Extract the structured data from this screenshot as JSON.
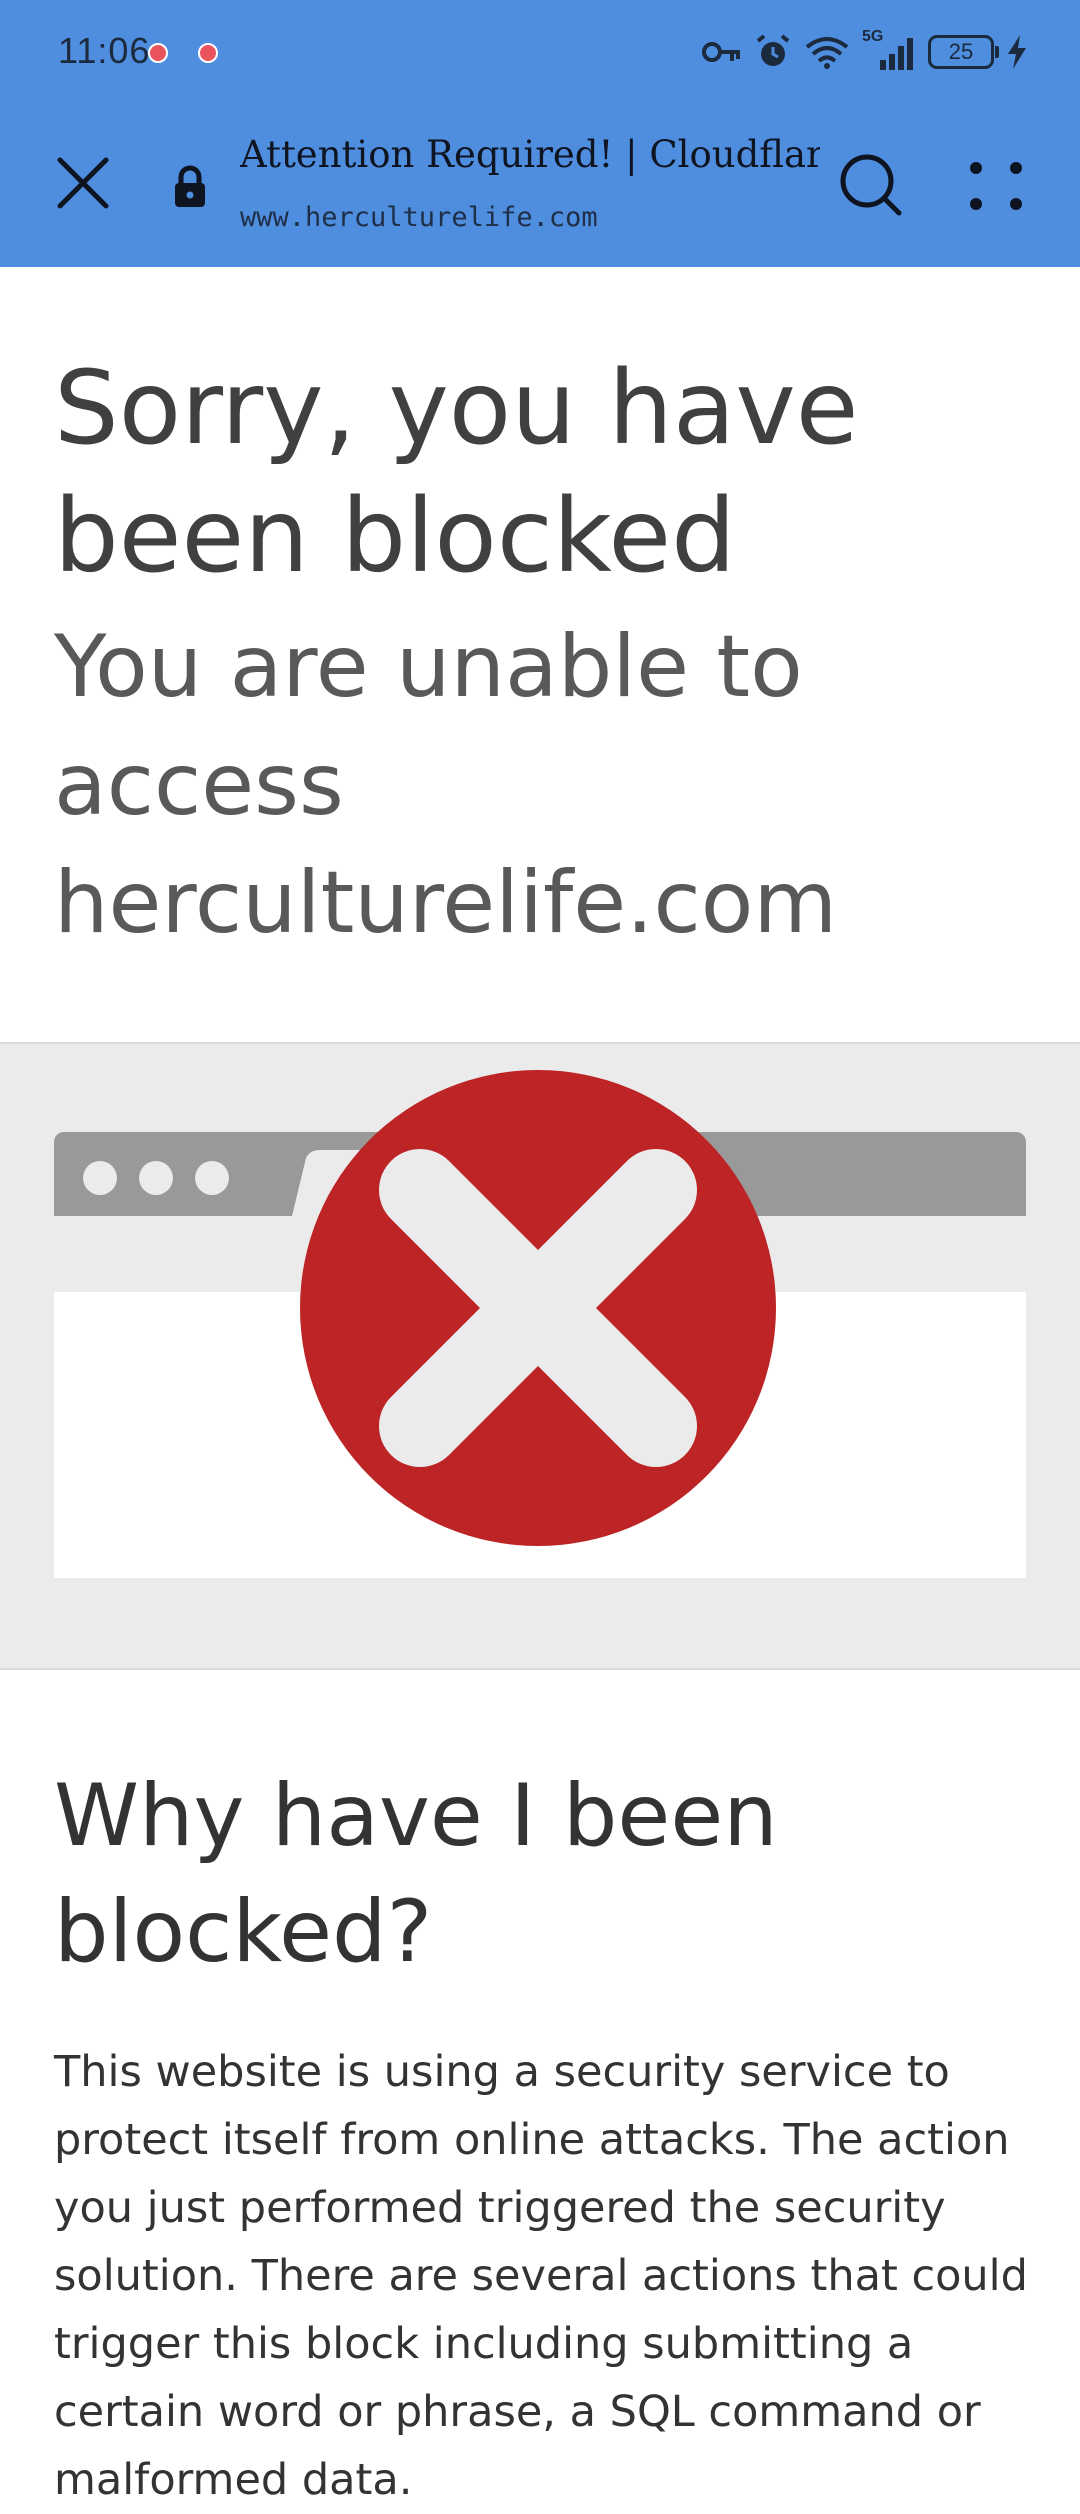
{
  "status_bar": {
    "time": "11:06",
    "network": "5G",
    "battery_level": "25",
    "icons": [
      "notification-dot-icon",
      "notification-dot-icon",
      "key-icon",
      "alarm-icon",
      "wifi-icon",
      "signal-icon",
      "battery-icon",
      "charging-bolt-icon"
    ]
  },
  "toolbar": {
    "page_title": "Attention Required! | Cloudflare",
    "url": "www.herculturelife.com",
    "icons": [
      "close-icon",
      "lock-icon",
      "search-icon",
      "more-menu-icon"
    ]
  },
  "content": {
    "headline": "Sorry, you have been blocked",
    "subheadline": "You are unable to access herculturelife.com",
    "why_heading": "Why have I been blocked?",
    "explanation": "This website is using a security service to protect itself from online attacks. The action you just performed triggered the security solution. There are several actions that could trigger this block including submitting a certain word or phrase, a SQL command or malformed data."
  },
  "colors": {
    "toolbar_background": "#4f8ddf",
    "error_red": "#bd2426",
    "illustration_band": "#ebebeb",
    "browser_chrome_gray": "#999999"
  }
}
